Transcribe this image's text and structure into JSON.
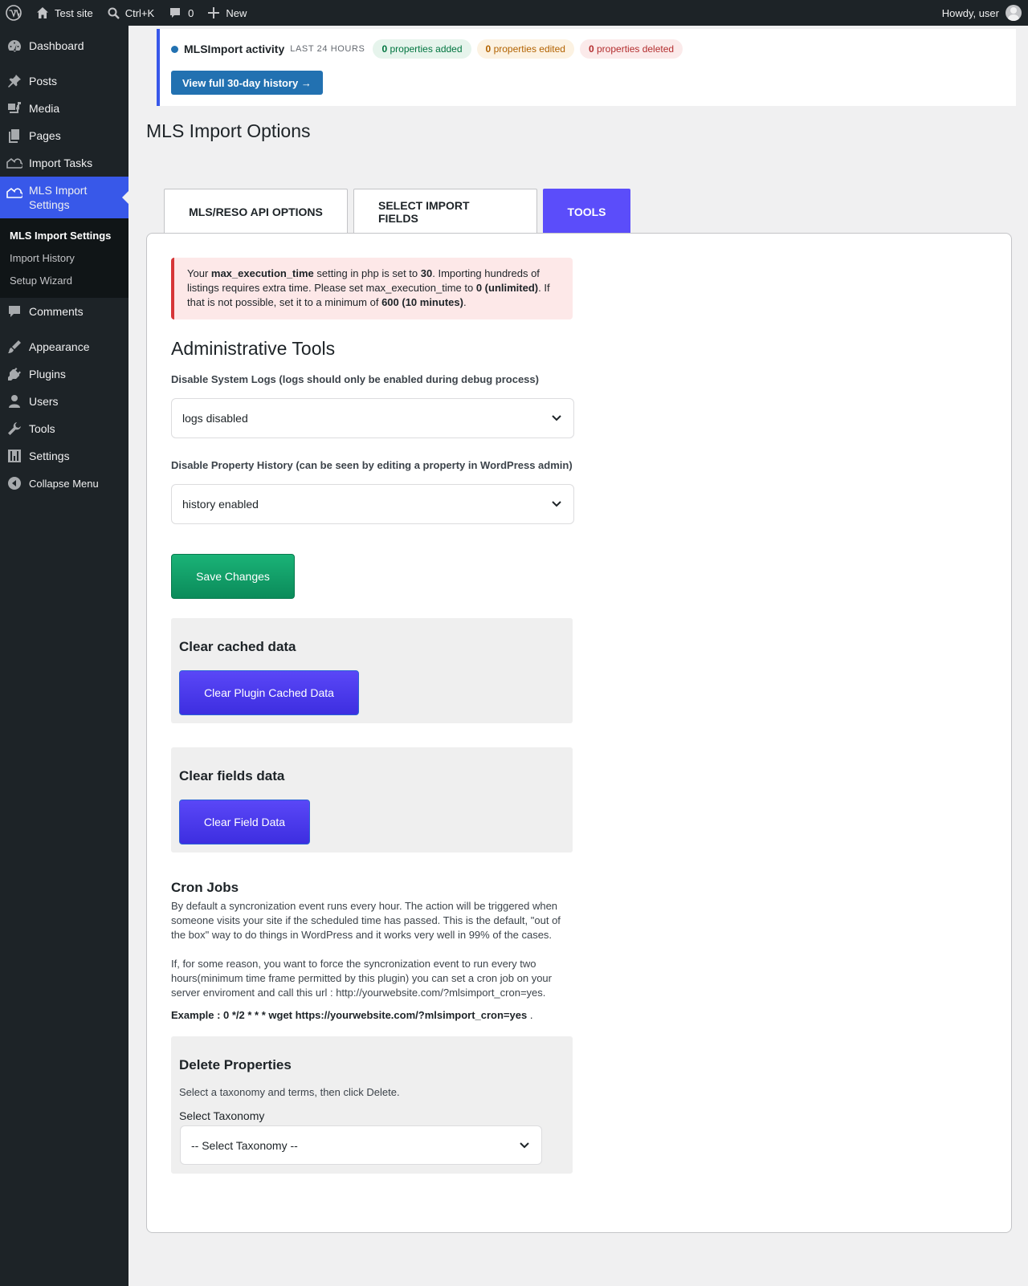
{
  "adminbar": {
    "site_name": "Test site",
    "search_shortcut": "Ctrl+K",
    "comments_count": "0",
    "new_label": "New",
    "greeting": "Howdy, user"
  },
  "sidebar": {
    "items": [
      {
        "label": "Dashboard",
        "icon": "dashboard-icon"
      },
      {
        "label": "Posts",
        "icon": "pin-icon"
      },
      {
        "label": "Media",
        "icon": "media-icon"
      },
      {
        "label": "Pages",
        "icon": "pages-icon"
      },
      {
        "label": "Import Tasks",
        "icon": "cloud-house-icon"
      },
      {
        "label": "MLS Import Settings",
        "icon": "cloud-house-icon"
      },
      {
        "label": "Comments",
        "icon": "comment-icon"
      },
      {
        "label": "Appearance",
        "icon": "brush-icon"
      },
      {
        "label": "Plugins",
        "icon": "plug-icon"
      },
      {
        "label": "Users",
        "icon": "user-icon"
      },
      {
        "label": "Tools",
        "icon": "wrench-icon"
      },
      {
        "label": "Settings",
        "icon": "sliders-icon"
      },
      {
        "label": "Collapse Menu",
        "icon": "collapse-icon"
      }
    ],
    "submenu": [
      "MLS Import Settings",
      "Import History",
      "Setup Wizard"
    ]
  },
  "activity": {
    "title": "MLSImport activity",
    "period": "LAST 24 HOURS",
    "added_count": "0",
    "added_label": "properties added",
    "edited_count": "0",
    "edited_label": "properties edited",
    "deleted_count": "0",
    "deleted_label": "properties deleted",
    "history_button": "View full 30-day history →"
  },
  "page_title": "MLS Import Options",
  "tabs": [
    "MLS/RESO API OPTIONS",
    "SELECT IMPORT FIELDS",
    "TOOLS"
  ],
  "notice": {
    "t1": "Your ",
    "b1": "max_execution_time",
    "t2": " setting in php is set to ",
    "b2": "30",
    "t3": ". Importing hundreds of listings requires extra time. Please set max_execution_time to ",
    "b3": "0 (unlimited)",
    "t4": ". If that is not possible, set it to a minimum of ",
    "b4": "600 (10 minutes)",
    "t5": "."
  },
  "admin_tools": {
    "title": "Administrative Tools",
    "logs_label": "Disable System Logs (logs should only be enabled during debug process)",
    "logs_value": "logs disabled",
    "history_label": "Disable Property History (can be seen by editing a property in WordPress admin)",
    "history_value": "history enabled",
    "save_button": "Save Changes"
  },
  "clear_cache": {
    "title": "Clear cached data",
    "button": "Clear Plugin Cached Data"
  },
  "clear_fields": {
    "title": "Clear fields data",
    "button": "Clear Field Data"
  },
  "cron": {
    "title": "Cron Jobs",
    "p1": "By default a syncronization event runs every hour. The action will be triggered when someone visits your site if the scheduled time has passed. This is the default, \"out of the box\" way to do things in WordPress and it works very well in 99% of the cases.",
    "p2": "If, for some reason, you want to force the syncronization event to run every two hours(minimum time frame permitted by this plugin) you can set a cron job on your server enviroment and call this url : http://yourwebsite.com/?mlsimport_cron=yes.",
    "example": "Example : 0 */2 * * * wget https://yourwebsite.com/?mlsimport_cron=yes",
    "example_suffix": " ."
  },
  "delete_props": {
    "title": "Delete Properties",
    "desc": "Select a taxonomy and terms, then click Delete.",
    "taxonomy_label": "Select Taxonomy",
    "taxonomy_value": "-- Select Taxonomy --"
  }
}
